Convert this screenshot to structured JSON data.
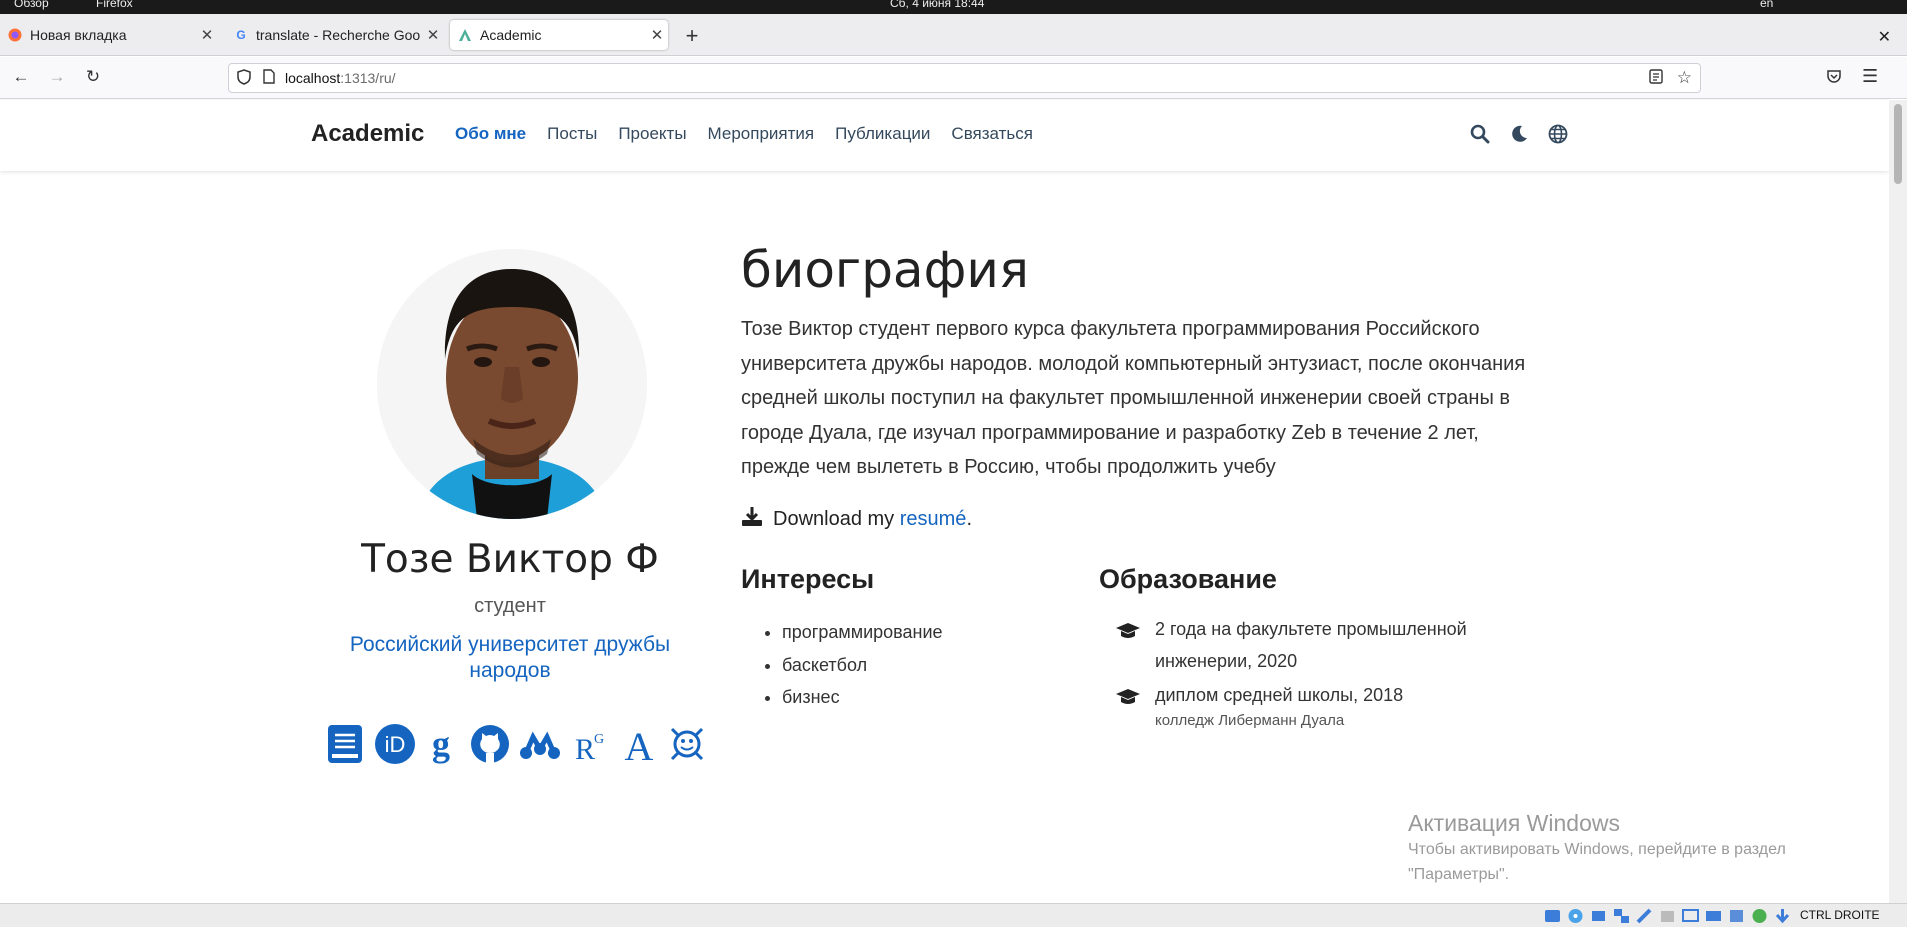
{
  "system": {
    "left_label": "Обзор",
    "app_label": "Firefox",
    "clock": "Сб, 4 июня  18:44",
    "lang": "en"
  },
  "browser": {
    "tabs": [
      {
        "title": "Новая вкладка"
      },
      {
        "title": "translate - Recherche Goo"
      },
      {
        "title": "Academic"
      }
    ],
    "url_host": "localhost",
    "url_path": ":1313/ru/"
  },
  "site": {
    "brand": "Academic",
    "menu": [
      "Обо мне",
      "Посты",
      "Проекты",
      "Мероприятия",
      "Публикации",
      "Связаться"
    ],
    "icons": [
      "search-icon",
      "moon-icon",
      "globe-icon"
    ]
  },
  "profile": {
    "name": "Тозе Виктор Ф",
    "role": "студент",
    "organization": "Российский университет дружбы народов",
    "social_icons": [
      "cv-book-icon",
      "orcid-icon",
      "google-scholar-icon",
      "github-icon",
      "mendeley-icon",
      "researchgate-icon",
      "academia-icon",
      "ai-icon"
    ]
  },
  "bio": {
    "title": "биография",
    "text": "Тозе Виктор студент первого курса факультета программирования Российского университета дружбы народов. молодой компьютерный энтузиаст, после окончания средней школы поступил на факультет промышленной инженерии своей страны в городе Дуала, где изучал программирование и разработку Zeb в течение 2 лет, прежде чем вылететь в Россию, чтобы продолжить учебу",
    "download_prefix": "Download my ",
    "download_link": "resumé",
    "download_suffix": "."
  },
  "interests": {
    "title": "Интересы",
    "items": [
      "программирование",
      "баскетбол",
      "бизнес"
    ]
  },
  "education": {
    "title": "Образование",
    "items": [
      {
        "course": "2 года на факультете промышленной инженерии, 2020",
        "institution": ""
      },
      {
        "course": "диплом средней школы, 2018",
        "institution": "колледж Либерманн Дуала"
      }
    ]
  },
  "watermark": {
    "title": "Активация Windows",
    "line1": "Чтобы активировать Windows, перейдите в раздел",
    "line2": "\"Параметры\"."
  },
  "taskbar": {
    "keyboard_label": "CTRL DROITE"
  },
  "colors": {
    "accent": "#1565c0",
    "nav_text": "#34495e"
  }
}
